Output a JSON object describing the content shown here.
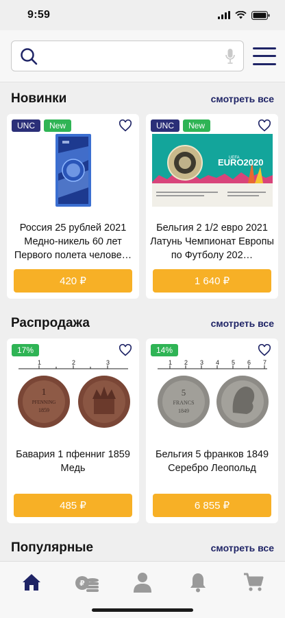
{
  "status": {
    "time": "9:59"
  },
  "search": {
    "placeholder": "",
    "value": ""
  },
  "sections": [
    {
      "title": "Новинки",
      "see_all": "смотреть все",
      "cards": [
        {
          "badges": [
            "UNC",
            "New"
          ],
          "title": "Россия 25 рублей 2021 Медно-никель 60 лет Первого полета челове…",
          "price": "420 ₽"
        },
        {
          "badges": [
            "UNC",
            "New"
          ],
          "title": "Бельгия 2 1/2 евро 2021 Латунь Чемпионат Европы по Футболу 202…",
          "price": "1 640 ₽",
          "image_text": "EURO2020"
        }
      ]
    },
    {
      "title": "Распродажа",
      "see_all": "смотреть все",
      "cards": [
        {
          "badges": [
            "17%"
          ],
          "title": "Бавария 1 пфенниг 1859 Медь",
          "price": "485 ₽",
          "ruler": [
            "1",
            "2",
            "3"
          ],
          "coin_text": [
            "1",
            "PFENNING",
            "1859"
          ]
        },
        {
          "badges": [
            "14%"
          ],
          "title": "Бельгия 5 франков 1849 Серебро Леопольд",
          "price": "6 855 ₽",
          "ruler": [
            "1",
            "2",
            "3",
            "4",
            "5",
            "6",
            "7"
          ],
          "coin_text": [
            "5",
            "FRANCS",
            "1849"
          ]
        }
      ]
    },
    {
      "title": "Популярные",
      "see_all": "смотреть все"
    }
  ],
  "tabs": [
    "home-icon",
    "coins-icon",
    "profile-icon",
    "notifications-icon",
    "cart-icon"
  ],
  "colors": {
    "accent": "#1f2466",
    "price": "#f7b026",
    "badge_unc": "#2b2f78",
    "badge_green": "#2fb455"
  }
}
